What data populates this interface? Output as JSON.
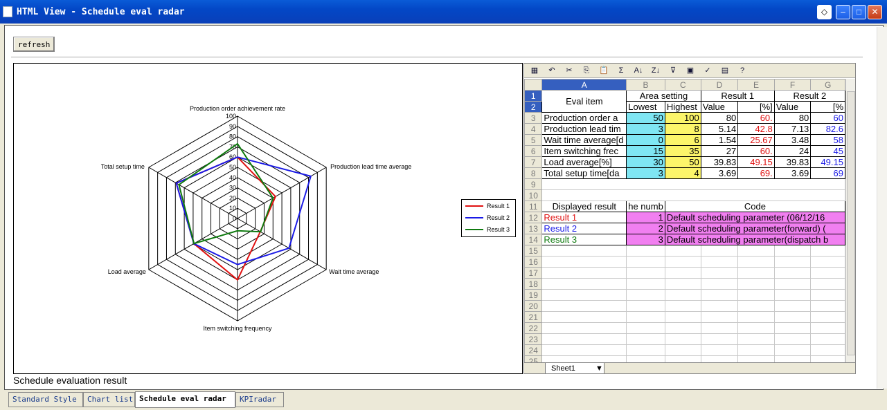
{
  "window": {
    "title": "HTML View - Schedule eval radar"
  },
  "toolbar": {
    "refresh_label": "refresh"
  },
  "caption": "Schedule evaluation result",
  "chart_data": {
    "type": "radar",
    "axes": [
      "Production order achievement rate",
      "Production lead time average",
      "Wait time average",
      "Item switching frequency",
      "Load average",
      "Total setup time"
    ],
    "ticks": [
      "0",
      "10",
      "20",
      "30",
      "40",
      "50",
      "60",
      "70",
      "80",
      "90",
      "100"
    ],
    "range": [
      0,
      100
    ],
    "series": [
      {
        "name": "Result 1",
        "color": "#e01010",
        "values": [
          60,
          42.8,
          25.67,
          60,
          49.15,
          69
        ]
      },
      {
        "name": "Result 2",
        "color": "#1a1ae6",
        "values": [
          60,
          82.6,
          58,
          45,
          49.15,
          69
        ]
      },
      {
        "name": "Result 3",
        "color": "#0f7a0f",
        "values": [
          73,
          40,
          26,
          12,
          49,
          66
        ]
      }
    ],
    "legend": "right"
  },
  "sheet": {
    "col_headers": [
      "A",
      "B",
      "C",
      "D",
      "E",
      "F",
      "G"
    ],
    "row_headers": [
      "1",
      "2",
      "3",
      "4",
      "5",
      "6",
      "7",
      "8",
      "9",
      "10",
      "11",
      "12",
      "13",
      "14",
      "15",
      "16",
      "17",
      "18",
      "19",
      "20",
      "21",
      "22",
      "23",
      "24",
      "25"
    ],
    "tab": "Sheet1",
    "h_eval": "Eval item",
    "h_area": "Area setting",
    "h_r1": "Result 1",
    "h_r2": "Result 2",
    "h_low": "Lowest",
    "h_high": "Highest",
    "h_value": "Value",
    "h_pct": "[%]",
    "h_value2": "Value",
    "h_pct2": "[%",
    "rows": [
      {
        "item": "Production order a",
        "low": "50",
        "high": "100",
        "v1": "80",
        "p1": "60.",
        "v2": "80",
        "p2": "60"
      },
      {
        "item": "Production lead tim",
        "low": "3",
        "high": "8",
        "v1": "5.14",
        "p1": "42.8",
        "v2": "7.13",
        "p2": "82.6"
      },
      {
        "item": "Wait time average[d",
        "low": "0",
        "high": "6",
        "v1": "1.54",
        "p1": "25.67",
        "v2": "3.48",
        "p2": "58"
      },
      {
        "item": "Item switching frec",
        "low": "15",
        "high": "35",
        "v1": "27",
        "p1": "60.",
        "v2": "24",
        "p2": "45"
      },
      {
        "item": "Load average[%]",
        "low": "30",
        "high": "50",
        "v1": "39.83",
        "p1": "49.15",
        "v2": "39.83",
        "p2": "49.15"
      },
      {
        "item": "Total setup time[da",
        "low": "3",
        "high": "4",
        "v1": "3.69",
        "p1": "69.",
        "v2": "3.69",
        "p2": "69"
      }
    ],
    "h_displayed": "Displayed result",
    "h_number": "he numb",
    "h_code": "Code",
    "results": [
      {
        "name": "Result 1",
        "num": "1",
        "code": "Default scheduling parameter (06/12/16"
      },
      {
        "name": "Result 2",
        "num": "2",
        "code": "Default scheduling parameter(forward) ("
      },
      {
        "name": "Result 3",
        "num": "3",
        "code": "Default scheduling parameter(dispatch b"
      }
    ]
  },
  "bottom_tabs": [
    "Standard Style",
    "Chart list",
    "Schedule eval radar",
    "KPIradar"
  ]
}
